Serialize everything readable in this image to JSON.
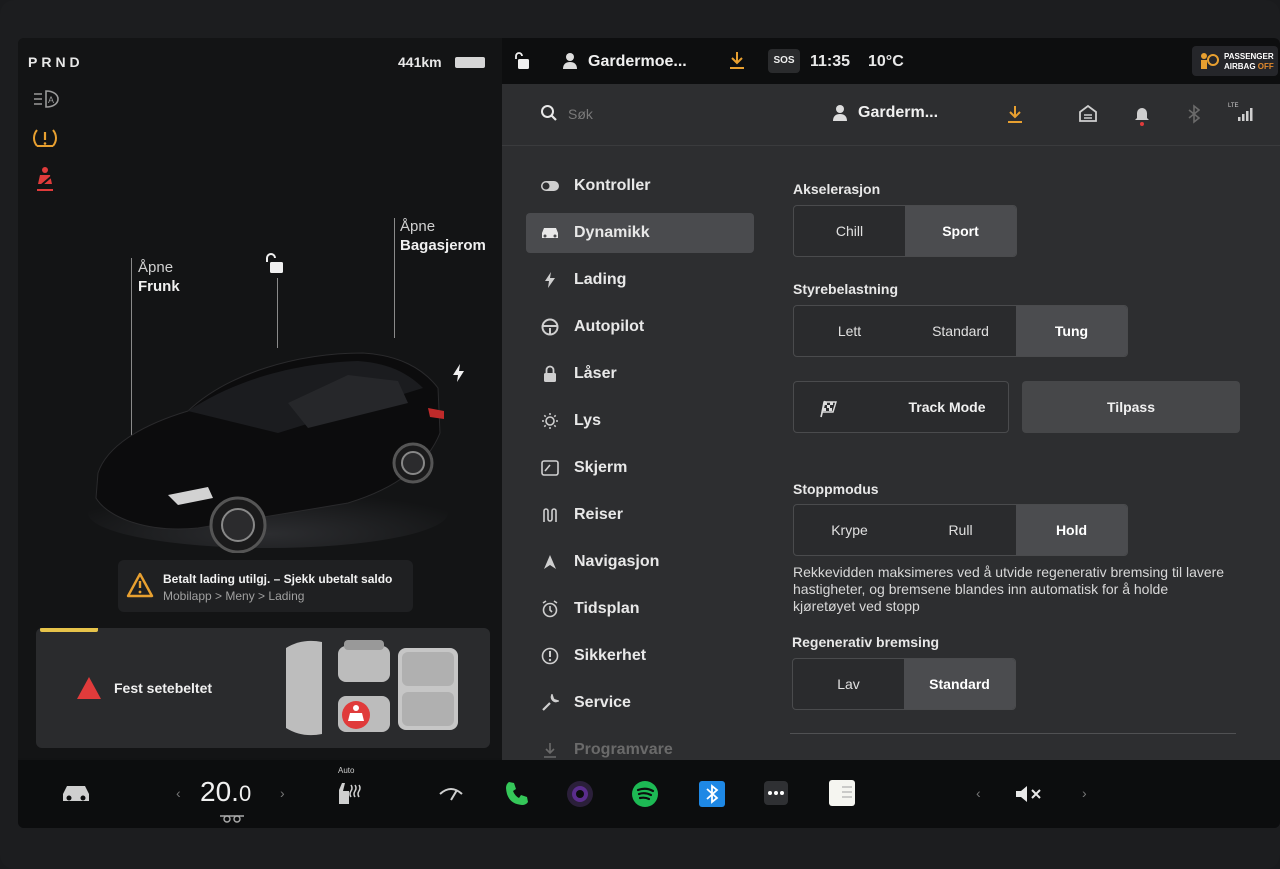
{
  "status": {
    "gear": "PRND",
    "range": "441km",
    "destination": "Gardermoe...",
    "sos": "SOS",
    "time": "11:35",
    "outside_temp": "10°C",
    "airbag_line1": "PASSENGER",
    "airbag_line2_prefix": "AIRBAG",
    "airbag_line2_state": "OFF"
  },
  "car": {
    "frunk_action": "Åpne",
    "frunk_label": "Frunk",
    "trunk_action": "Åpne",
    "trunk_label": "Bagasjerom"
  },
  "alerts": {
    "payment_title": "Betalt lading utilgj. – Sjekk ubetalt saldo",
    "payment_path": "Mobilapp > Meny > Lading",
    "seatbelt": "Fest setebeltet"
  },
  "header": {
    "search_placeholder": "Søk",
    "profile_name": "Garderm...",
    "lte": "LTE"
  },
  "menu": [
    {
      "label": "Kontroller",
      "icon": "toggle-icon"
    },
    {
      "label": "Dynamikk",
      "icon": "car-icon",
      "active": true
    },
    {
      "label": "Lading",
      "icon": "bolt-icon"
    },
    {
      "label": "Autopilot",
      "icon": "steering-wheel-icon"
    },
    {
      "label": "Låser",
      "icon": "lock-icon"
    },
    {
      "label": "Lys",
      "icon": "sun-icon"
    },
    {
      "label": "Skjerm",
      "icon": "display-icon"
    },
    {
      "label": "Reiser",
      "icon": "route-icon"
    },
    {
      "label": "Navigasjon",
      "icon": "navigation-arrow-icon"
    },
    {
      "label": "Tidsplan",
      "icon": "alarm-clock-icon"
    },
    {
      "label": "Sikkerhet",
      "icon": "info-circle-icon"
    },
    {
      "label": "Service",
      "icon": "wrench-icon"
    },
    {
      "label": "Programvare",
      "icon": "download-icon"
    }
  ],
  "dynamics": {
    "acceleration": {
      "title": "Akselerasjon",
      "options": [
        "Chill",
        "Sport"
      ],
      "selected": "Sport"
    },
    "steering": {
      "title": "Styrebelastning",
      "options": [
        "Lett",
        "Standard",
        "Tung"
      ],
      "selected": "Tung"
    },
    "track_mode": "Track Mode",
    "customize": "Tilpass",
    "stop_mode": {
      "title": "Stoppmodus",
      "options": [
        "Krype",
        "Rull",
        "Hold"
      ],
      "selected": "Hold"
    },
    "stop_description": "Rekkevidden maksimeres ved å utvide regenerativ bremsing til lavere hastigheter, og bremsene blandes inn automatisk for å holde kjøretøyet ved stopp",
    "regen": {
      "title": "Regenerativ bremsing",
      "options": [
        "Lav",
        "Standard"
      ],
      "selected": "Standard"
    }
  },
  "dock": {
    "cabin_temp_main": "20.",
    "cabin_temp_decimal": "0",
    "seat_heat_label": "Auto"
  },
  "colors": {
    "accent_orange": "#e8a030",
    "alert_red": "#e03b3b",
    "phone_green": "#35c759",
    "spotify_green": "#1db954",
    "bluetooth_blue": "#1e88e5"
  }
}
